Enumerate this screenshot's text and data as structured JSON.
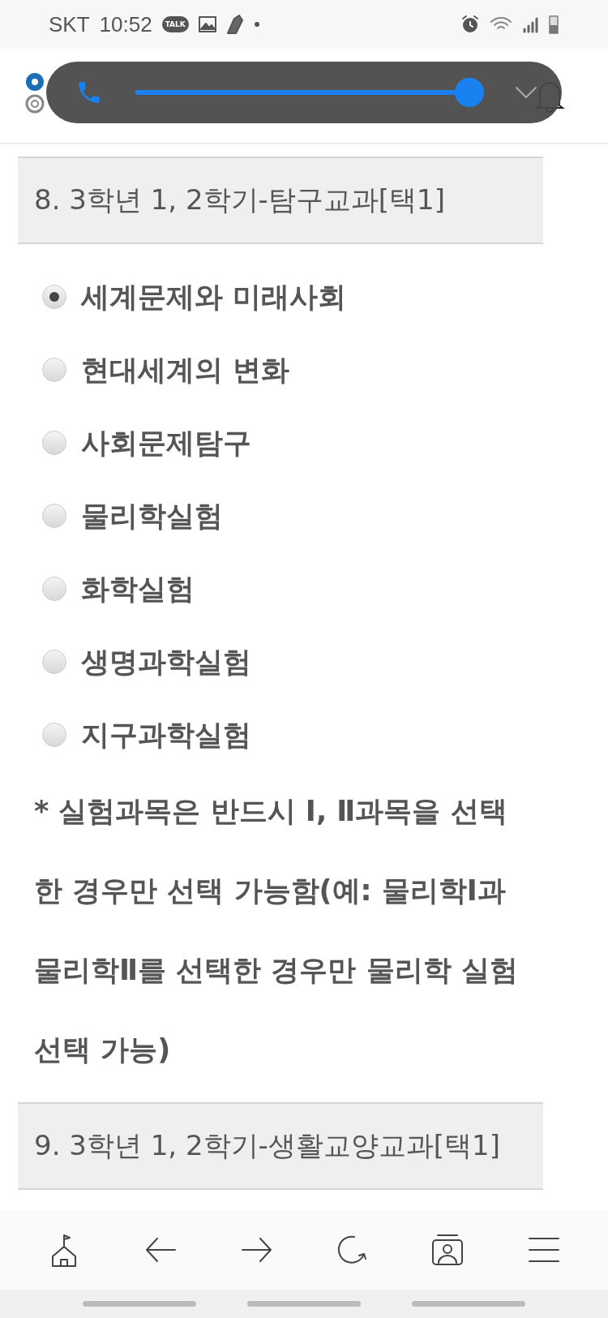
{
  "status_bar": {
    "carrier": "SKT",
    "time": "10:52",
    "talk_badge": "TALK"
  },
  "volume_popup": {
    "level": 1
  },
  "sections": [
    {
      "title": "8. 3학년 1, 2학기-탐구교과[택1]",
      "options": [
        {
          "label": "세계문제와 미래사회",
          "selected": true
        },
        {
          "label": "현대세계의 변화",
          "selected": false
        },
        {
          "label": "사회문제탐구",
          "selected": false
        },
        {
          "label": "물리학실험",
          "selected": false
        },
        {
          "label": "화학실험",
          "selected": false
        },
        {
          "label": "생명과학실험",
          "selected": false
        },
        {
          "label": "지구과학실험",
          "selected": false
        }
      ],
      "note": "* 실험과목은 반드시 Ⅰ, Ⅱ과목을 선택한 경우만 선택 가능함(예: 물리학Ⅰ과 물리학Ⅱ를 선택한 경우만 물리학 실험 선택 가능)"
    },
    {
      "title": "9. 3학년 1, 2학기-생활교양교과[택1]"
    }
  ]
}
